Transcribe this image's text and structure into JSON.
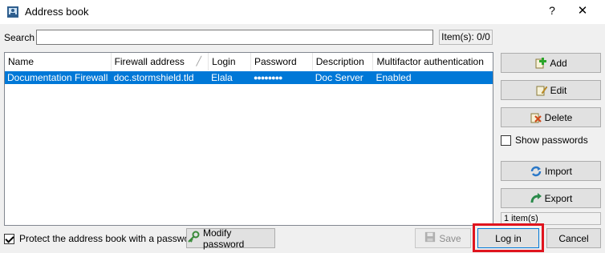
{
  "window": {
    "title": "Address book",
    "help": "?",
    "close": "✕"
  },
  "search": {
    "label": "Search",
    "value": "",
    "placeholder": "",
    "items_count": "Item(s): 0/0"
  },
  "table": {
    "columns": [
      "Name",
      "Firewall address",
      "Login",
      "Password",
      "Description",
      "Multifactor authentication"
    ],
    "rows": [
      {
        "name": "Documentation Firewall",
        "firewall_address": "doc.stormshield.tld",
        "login": "Elala",
        "password": "●●●●●●●●",
        "description": "Doc Server",
        "mfa": "Enabled"
      }
    ]
  },
  "sidebar": {
    "add": "Add",
    "edit": "Edit",
    "delete": "Delete",
    "show_passwords": "Show passwords",
    "show_passwords_checked": false,
    "import": "Import",
    "export": "Export",
    "item_count": "1 item(s)"
  },
  "footer": {
    "protect_label": "Protect the address book with a password",
    "protect_checked": true,
    "modify_password": "Modify password",
    "save": "Save",
    "login": "Log in",
    "cancel": "Cancel"
  },
  "colors": {
    "selection": "#0078d7",
    "highlight": "#e0141e"
  }
}
